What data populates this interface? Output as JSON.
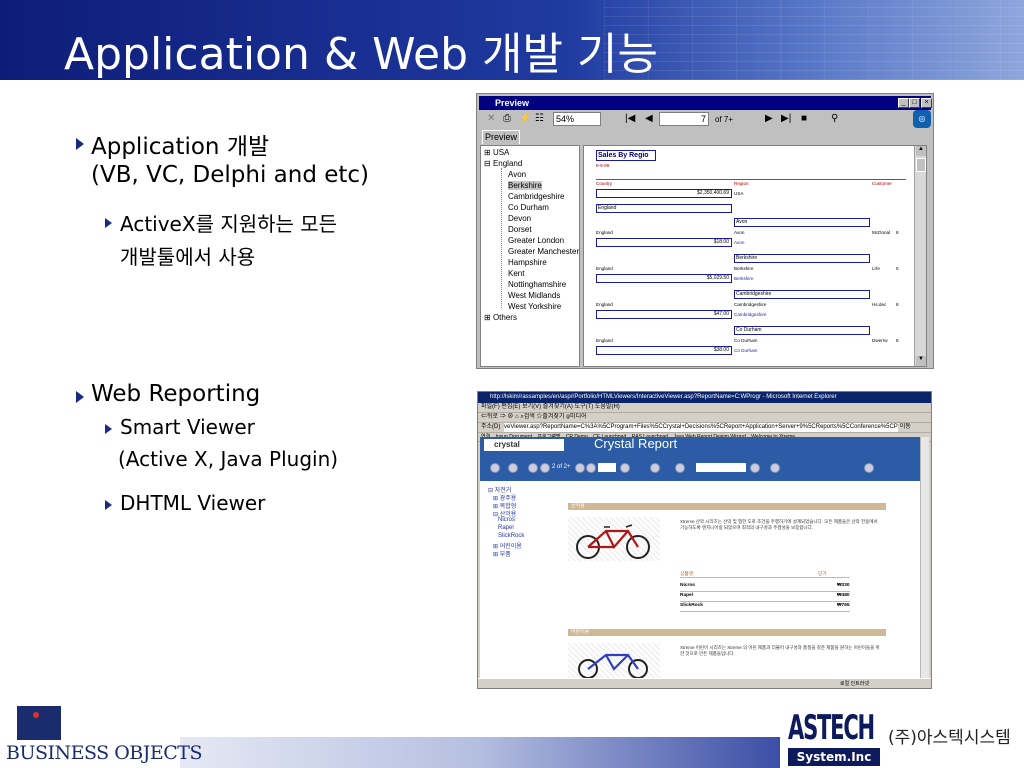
{
  "slide": {
    "title": "Application & Web 개발 기능",
    "bullets": {
      "app_dev": "Application 개발",
      "app_dev_sub": "(VB, VC, Delphi and etc)",
      "activex_line1": "ActiveX를  지원하는  모든",
      "activex_line2": "개발툴에서 사용",
      "web_reporting": "Web Reporting",
      "smart_viewer": "Smart Viewer",
      "smart_viewer_sub": "(Active X, Java Plugin)",
      "dhtml_viewer": "DHTML Viewer"
    },
    "footer": {
      "left_logo": "BUSINESS OBJECTS",
      "astech_logo": "ASTECH",
      "astech_system": "System.Inc",
      "astech_korean": "(주)아스텍시스템"
    }
  },
  "preview_window": {
    "title": "Preview",
    "zoom": "54%",
    "page_num": "7",
    "page_of": "of 7+",
    "tab_label": "Preview",
    "tree": {
      "usa": "USA",
      "england": "England",
      "avon": "Avon",
      "berkshire": "Berkshire",
      "cambridgeshire": "Cambridgeshire",
      "co_durham": "Co Durham",
      "devon": "Devon",
      "dorset": "Dorset",
      "greater_london": "Greater London",
      "greater_manchester": "Greater Manchester",
      "hampshire": "Hampshire",
      "kent": "Kent",
      "nottinghamshire": "Nottinghamshire",
      "west_midlands": "West Midlands",
      "west_yorkshire": "West Yorkshire",
      "others": "Others"
    },
    "report": {
      "title": "Sales By Regio",
      "date": "9-5-99",
      "col_country": "Country",
      "col_region": "Region",
      "col_customer": "Customer",
      "grand_total": "$2,350,400.69",
      "grand_region": "USA",
      "group_country": "England",
      "rows": [
        {
          "country": "England",
          "region": "Avon",
          "customer": "McDonal",
          "n": "8",
          "amount": "$18.00",
          "sub_region": "Avon"
        },
        {
          "country": "England",
          "region": "Berkshire",
          "customer": "Lrfe",
          "n": "5",
          "amount": "$5,029.50",
          "sub_region": "Berkshire"
        },
        {
          "country": "England",
          "region": "Cambridgeshire",
          "customer": "Hs.dec",
          "n": "8",
          "amount": "$47.00",
          "sub_region": "Cambridgeshire"
        },
        {
          "country": "England",
          "region": "Co Durham",
          "customer": "Dwerrw",
          "n": "8",
          "amount": "$38.00",
          "sub_region": "Co Durham"
        }
      ]
    }
  },
  "browser_window": {
    "title": "http://lskim/rassamples/en/asp/rPortfolio/HTMLViewers/InteractiveViewer.asp?ReportName=C:WProgr - Microsoft Internet Explorer",
    "menu": "파일(F)  편집(E)  보기(V)  즐겨찾기(A)  도구(T)  도움말(H)",
    "toolbar": "⇐뒤로  ⇒  ⊗  ⌂  ⌕검색  ☆즐겨찾기  ⊛미디어",
    "address_label": "주소(D)",
    "address": "veViewer.asp?ReportName=C%3A%5CProgram+Files%5CCrystal+Decisions%5CReport+Application+Server+9%5CReports%5CConference%5CProduct%2Ept",
    "go": "이동",
    "links_label": "연결",
    "links": [
      "Insun Document",
      "프로그램명",
      "CR Demo",
      "CE Launchpad",
      "RAS Launchpad",
      "Java Web Report Design Wizard",
      "Welcome to Xtreme"
    ],
    "crystal_logo": "crystal",
    "crystal_title": "Crystal Report",
    "page_info": "2 of 2+",
    "tree": [
      "자전거",
      "광주용",
      "복합형",
      "산악용",
      "Nicros",
      "Rapel",
      "SlickRock",
      "어린이용",
      "부품"
    ],
    "section1": "산악용",
    "section2": "어린이용",
    "para1": "Xtreme 산악 시리즈는 산악 및 험한 도로 조건을 주행하기에 설계되었습니다. 모든 제품들은 산악 전용에서 기능하도록 엔지니어링 되었으며 최적의 내구성과 주행성을 보증합니다.",
    "para2": "Xtreme 어린이 시리즈는 Xtreme 의 어린 제품과 더불어 내구성과 품질을 갖춘 제품을 원하는 어린이들을 위한 것으로 만든 제품들입니다.",
    "table_head_name": "상품명",
    "table_head_price": "단가",
    "table_rows": [
      {
        "name": "Nicros",
        "price": "₩330"
      },
      {
        "name": "Rapel",
        "price": "₩480"
      },
      {
        "name": "SlickRock",
        "price": "₩765"
      }
    ],
    "status": "로컬 인트라넷"
  },
  "colors": {
    "title_bar": "#1f3aa0",
    "bullet_arrow": "#1a2a80",
    "win_title": "#000080",
    "crystal_bar": "#2b5ca5"
  }
}
